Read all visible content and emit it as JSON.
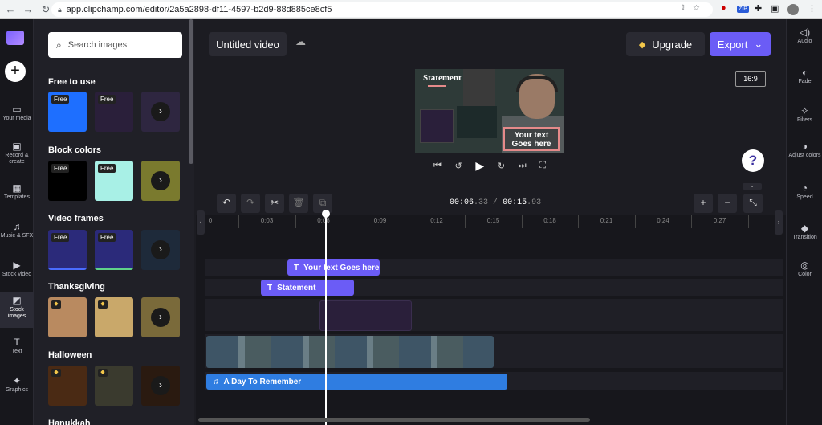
{
  "browser": {
    "url": "app.clipchamp.com/editor/2a5a2898-df11-4597-b2d9-88d885ce8cf5",
    "back": "←",
    "forward": "→",
    "reload": "↻",
    "ext_badge": "ZIP"
  },
  "left_rail": {
    "items": [
      {
        "label": "Your media",
        "icon": "▭"
      },
      {
        "label": "Record & create",
        "icon": "▣"
      },
      {
        "label": "Templates",
        "icon": "▦"
      },
      {
        "label": "Music & SFX",
        "icon": "♫"
      },
      {
        "label": "Stock video",
        "icon": "▶"
      },
      {
        "label": "Stock images",
        "icon": "◩"
      },
      {
        "label": "Text",
        "icon": "T"
      },
      {
        "label": "Graphics",
        "icon": "✦"
      }
    ]
  },
  "panel": {
    "search_placeholder": "Search images",
    "sections": [
      {
        "title": "Free to use",
        "badge": "Free"
      },
      {
        "title": "Block colors",
        "badge": "Free"
      },
      {
        "title": "Video frames",
        "badge": "Free"
      },
      {
        "title": "Thanksgiving"
      },
      {
        "title": "Halloween"
      },
      {
        "title": "Hanukkah"
      }
    ],
    "arrow": "›"
  },
  "header": {
    "project_title": "Untitled video",
    "upgrade_label": "Upgrade",
    "export_label": "Export",
    "export_chevron": "⌄"
  },
  "preview": {
    "aspect_ratio": "16:9",
    "statement_text": "Statement",
    "overlay_text": "Your text Goes here",
    "help": "?"
  },
  "timeline": {
    "current_time_main": "00:06",
    "current_time_frac": ".33",
    "separator": "/",
    "total_time_main": "00:15",
    "total_time_frac": ".93",
    "ruler_ticks": [
      "0",
      "0:03",
      "0:06",
      "0:09",
      "0:12",
      "0:15",
      "0:18",
      "0:21",
      "0:24",
      "0:27"
    ],
    "clips": {
      "text1": "Your text Goes here",
      "text2": "Statement",
      "audio": "A Day To Remember"
    }
  },
  "right_rail": {
    "items": [
      {
        "label": "Audio",
        "icon": "◁)"
      },
      {
        "label": "Fade",
        "icon": "◐"
      },
      {
        "label": "Filters",
        "icon": "✧"
      },
      {
        "label": "Adjust colors",
        "icon": "◑"
      },
      {
        "label": "Speed",
        "icon": "◔"
      },
      {
        "label": "Transition",
        "icon": "◆"
      },
      {
        "label": "Color",
        "icon": "◎"
      }
    ]
  },
  "colors": {
    "accent": "#6b5cf6",
    "audio": "#2f7de1",
    "premium": "#f3c74a"
  }
}
